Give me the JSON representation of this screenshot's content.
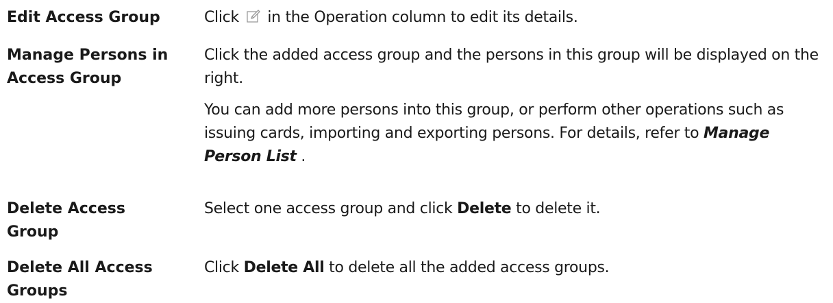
{
  "rows": [
    {
      "term": "Edit Access Group",
      "desc_before_icon": "Click ",
      "desc_after_icon": " in the Operation column to edit its details.",
      "icon": "edit-icon"
    },
    {
      "term_line1": "Manage Persons in",
      "term_line2": "Access Group",
      "para1": "Click the added access group and the persons in this group will be displayed on the right.",
      "para2_text": "You can add more persons into this group, or perform other operations such as issuing cards, importing and exporting persons. For details, refer to ",
      "para2_link": "Manage Person List",
      "para2_end": " ."
    },
    {
      "term_line1": "Delete Access",
      "term_line2": "Group",
      "desc_before": "Select one access group and click ",
      "desc_bold": "Delete",
      "desc_after": " to delete it."
    },
    {
      "term_line1": "Delete All Access",
      "term_line2": "Groups",
      "desc_before": "Click ",
      "desc_bold": "Delete All",
      "desc_after": " to delete all the added access groups."
    }
  ]
}
